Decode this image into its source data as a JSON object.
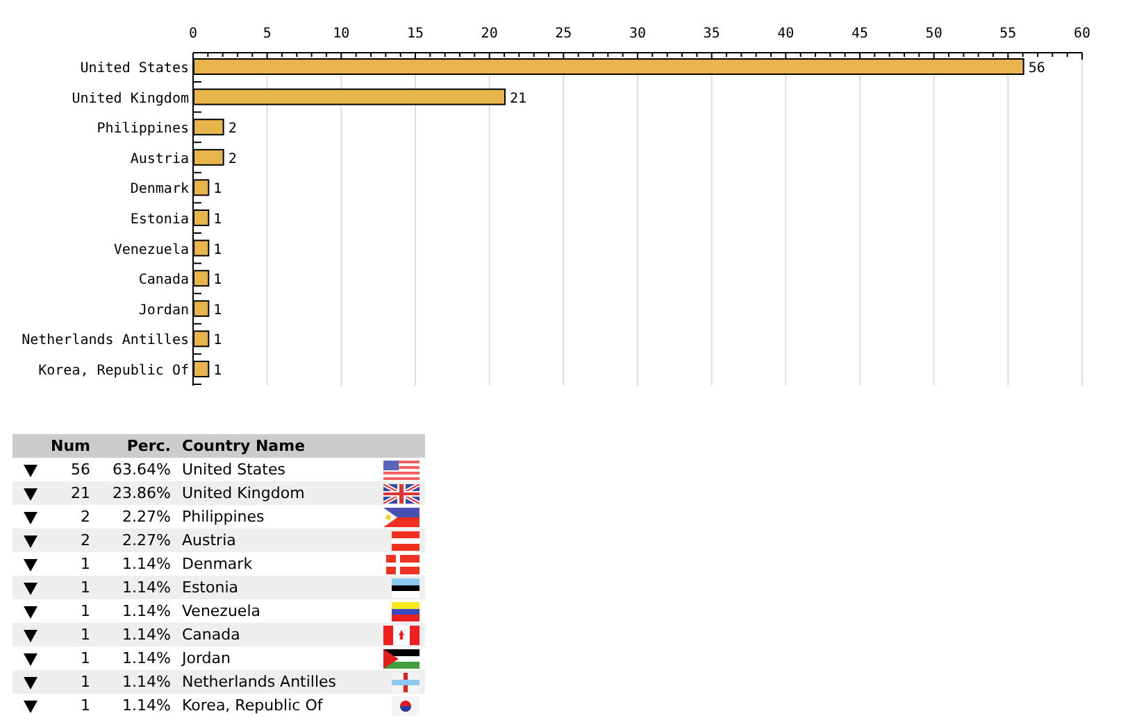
{
  "chart": {
    "chart_data": {
      "type": "bar",
      "orientation": "horizontal",
      "categories": [
        "United States",
        "United Kingdom",
        "Philippines",
        "Austria",
        "Denmark",
        "Estonia",
        "Venezuela",
        "Canada",
        "Jordan",
        "Netherlands Antilles",
        "Korea, Republic Of"
      ],
      "values": [
        56,
        21,
        2,
        2,
        1,
        1,
        1,
        1,
        1,
        1,
        1
      ],
      "xlim": [
        0,
        60
      ],
      "xticks": [
        0,
        5,
        10,
        15,
        20,
        25,
        30,
        35,
        40,
        45,
        50,
        55,
        60
      ],
      "data_labels": true,
      "grid": true
    }
  },
  "table": {
    "columns": [
      "Num",
      "Perc.",
      "Country Name"
    ],
    "rows": [
      {
        "num": "56",
        "perc": "63.64%",
        "country": "United States"
      },
      {
        "num": "21",
        "perc": "23.86%",
        "country": "United Kingdom"
      },
      {
        "num": "2",
        "perc": "2.27%",
        "country": "Philippines"
      },
      {
        "num": "2",
        "perc": "2.27%",
        "country": "Austria"
      },
      {
        "num": "1",
        "perc": "1.14%",
        "country": "Denmark"
      },
      {
        "num": "1",
        "perc": "1.14%",
        "country": "Estonia"
      },
      {
        "num": "1",
        "perc": "1.14%",
        "country": "Venezuela"
      },
      {
        "num": "1",
        "perc": "1.14%",
        "country": "Canada"
      },
      {
        "num": "1",
        "perc": "1.14%",
        "country": "Jordan"
      },
      {
        "num": "1",
        "perc": "1.14%",
        "country": "Netherlands Antilles"
      },
      {
        "num": "1",
        "perc": "1.14%",
        "country": "Korea, Republic Of"
      }
    ]
  }
}
